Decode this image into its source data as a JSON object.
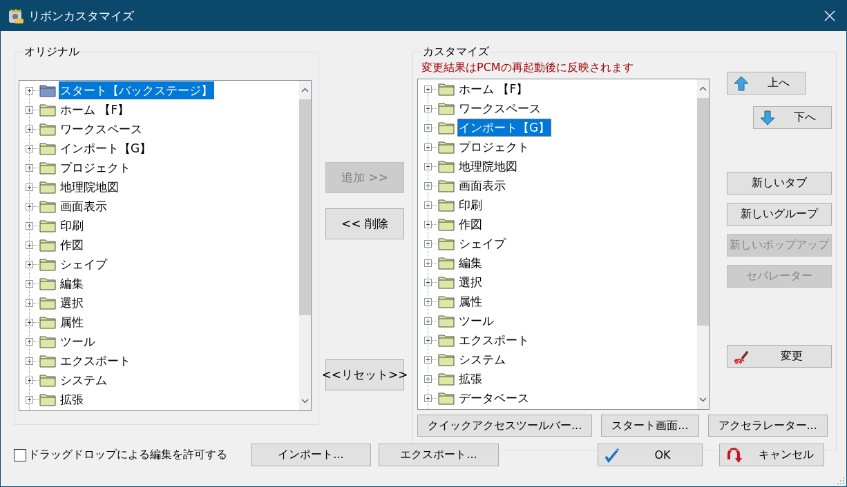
{
  "window": {
    "title": "リボンカスタマイズ"
  },
  "original": {
    "title": "オリジナル",
    "items": [
      {
        "label": "スタート【バックステージ】",
        "kind": "backstage",
        "selected": true
      },
      {
        "label": "ホーム 【F】",
        "kind": "tab",
        "selected": false
      },
      {
        "label": "ワークスペース",
        "kind": "tab",
        "selected": false
      },
      {
        "label": "インポート【G】",
        "kind": "tab",
        "selected": false
      },
      {
        "label": "プロジェクト",
        "kind": "tab",
        "selected": false
      },
      {
        "label": "地理院地図",
        "kind": "tab",
        "selected": false
      },
      {
        "label": "画面表示",
        "kind": "tab",
        "selected": false
      },
      {
        "label": "印刷",
        "kind": "tab",
        "selected": false
      },
      {
        "label": "作図",
        "kind": "tab",
        "selected": false
      },
      {
        "label": "シェイプ",
        "kind": "tab",
        "selected": false
      },
      {
        "label": "編集",
        "kind": "tab",
        "selected": false
      },
      {
        "label": "選択",
        "kind": "tab",
        "selected": false
      },
      {
        "label": "属性",
        "kind": "tab",
        "selected": false
      },
      {
        "label": "ツール",
        "kind": "tab",
        "selected": false
      },
      {
        "label": "エクスポート",
        "kind": "tab",
        "selected": false
      },
      {
        "label": "システム",
        "kind": "tab",
        "selected": false
      },
      {
        "label": "拡張",
        "kind": "tab",
        "selected": false
      }
    ]
  },
  "transfer_buttons": [
    {
      "label": "追加 >>",
      "disabled": true
    },
    {
      "label": "<< 削除",
      "disabled": false
    },
    {
      "label": "<<リセット>>",
      "disabled": false
    }
  ],
  "customize": {
    "title": "カスタマイズ",
    "notice": "変更結果はPCMの再起動後に反映されます",
    "items": [
      {
        "label": "ホーム 【F】",
        "kind": "tab",
        "selected": false
      },
      {
        "label": "ワークスペース",
        "kind": "tab",
        "selected": false
      },
      {
        "label": "インポート【G】",
        "kind": "tab",
        "selected": true
      },
      {
        "label": "プロジェクト",
        "kind": "tab",
        "selected": false
      },
      {
        "label": "地理院地図",
        "kind": "tab",
        "selected": false
      },
      {
        "label": "画面表示",
        "kind": "tab",
        "selected": false
      },
      {
        "label": "印刷",
        "kind": "tab",
        "selected": false
      },
      {
        "label": "作図",
        "kind": "tab",
        "selected": false
      },
      {
        "label": "シェイプ",
        "kind": "tab",
        "selected": false
      },
      {
        "label": "編集",
        "kind": "tab",
        "selected": false
      },
      {
        "label": "選択",
        "kind": "tab",
        "selected": false
      },
      {
        "label": "属性",
        "kind": "tab",
        "selected": false
      },
      {
        "label": "ツール",
        "kind": "tab",
        "selected": false
      },
      {
        "label": "エクスポート",
        "kind": "tab",
        "selected": false
      },
      {
        "label": "システム",
        "kind": "tab",
        "selected": false
      },
      {
        "label": "拡張",
        "kind": "tab",
        "selected": false
      },
      {
        "label": "データベース",
        "kind": "tab",
        "selected": false
      }
    ],
    "side_buttons": [
      {
        "label": "上へ",
        "kind": "up",
        "disabled": false
      },
      {
        "label": "下へ",
        "kind": "down",
        "disabled": false
      },
      {
        "label": "新しいタブ",
        "kind": "plain",
        "disabled": false
      },
      {
        "label": "新しいグループ",
        "kind": "plain",
        "disabled": false
      },
      {
        "label": "新しいポップアップ",
        "kind": "plain",
        "disabled": true
      },
      {
        "label": "セパレーター",
        "kind": "plain",
        "disabled": true
      },
      {
        "label": "変更",
        "kind": "edit",
        "disabled": false
      }
    ],
    "bottom_buttons": [
      {
        "label": "クイックアクセスツールバー..."
      },
      {
        "label": "スタート画面..."
      },
      {
        "label": "アクセラレーター..."
      }
    ]
  },
  "allow_drag_drop": {
    "label": "ドラッグドロップによる編集を許可する",
    "checked": false
  },
  "footer_buttons": [
    {
      "label": "インポート...",
      "kind": "plain"
    },
    {
      "label": "エクスポート...",
      "kind": "plain"
    },
    {
      "label": "OK",
      "kind": "ok"
    },
    {
      "label": "キャンセル",
      "kind": "cancel"
    }
  ]
}
